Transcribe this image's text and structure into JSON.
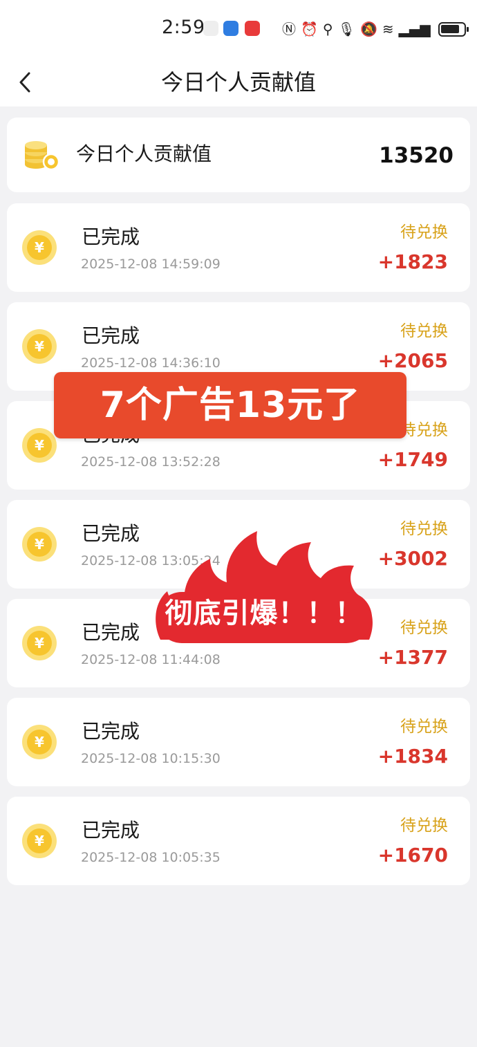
{
  "status_bar": {
    "time": "2:59",
    "icons": [
      "nfc-icon",
      "alarm-icon",
      "location-icon",
      "mic-icon",
      "mute-icon",
      "wifi-icon",
      "signal-4g-icon",
      "battery-icon"
    ]
  },
  "header": {
    "back_icon": "chevron-left-icon",
    "title": "今日个人贡献值"
  },
  "summary": {
    "icon": "coins-stack-icon",
    "label": "今日个人贡献值",
    "value": "13520"
  },
  "records": [
    {
      "status": "已完成",
      "time": "2025-12-08 14:59:09",
      "tag": "待兑换",
      "amount": "+1823"
    },
    {
      "status": "已完成",
      "time": "2025-12-08 14:36:10",
      "tag": "待兑换",
      "amount": "+2065"
    },
    {
      "status": "已完成",
      "time": "2025-12-08 13:52:28",
      "tag": "待兑换",
      "amount": "+1749"
    },
    {
      "status": "已完成",
      "time": "2025-12-08 13:05:24",
      "tag": "待兑换",
      "amount": "+3002"
    },
    {
      "status": "已完成",
      "time": "2025-12-08 11:44:08",
      "tag": "待兑换",
      "amount": "+1377"
    },
    {
      "status": "已完成",
      "time": "2025-12-08 10:15:30",
      "tag": "待兑换",
      "amount": "+1834"
    },
    {
      "status": "已完成",
      "time": "2025-12-08 10:05:35",
      "tag": "待兑换",
      "amount": "+1670"
    }
  ],
  "coin_symbol": "¥",
  "overlays": {
    "banner_text": "7个广告13元了",
    "fire_text": "彻底引爆！！！"
  },
  "colors": {
    "accent_red": "#d9362c",
    "pending_gold": "#d8a21a",
    "banner_bg": "#e84a2c"
  }
}
